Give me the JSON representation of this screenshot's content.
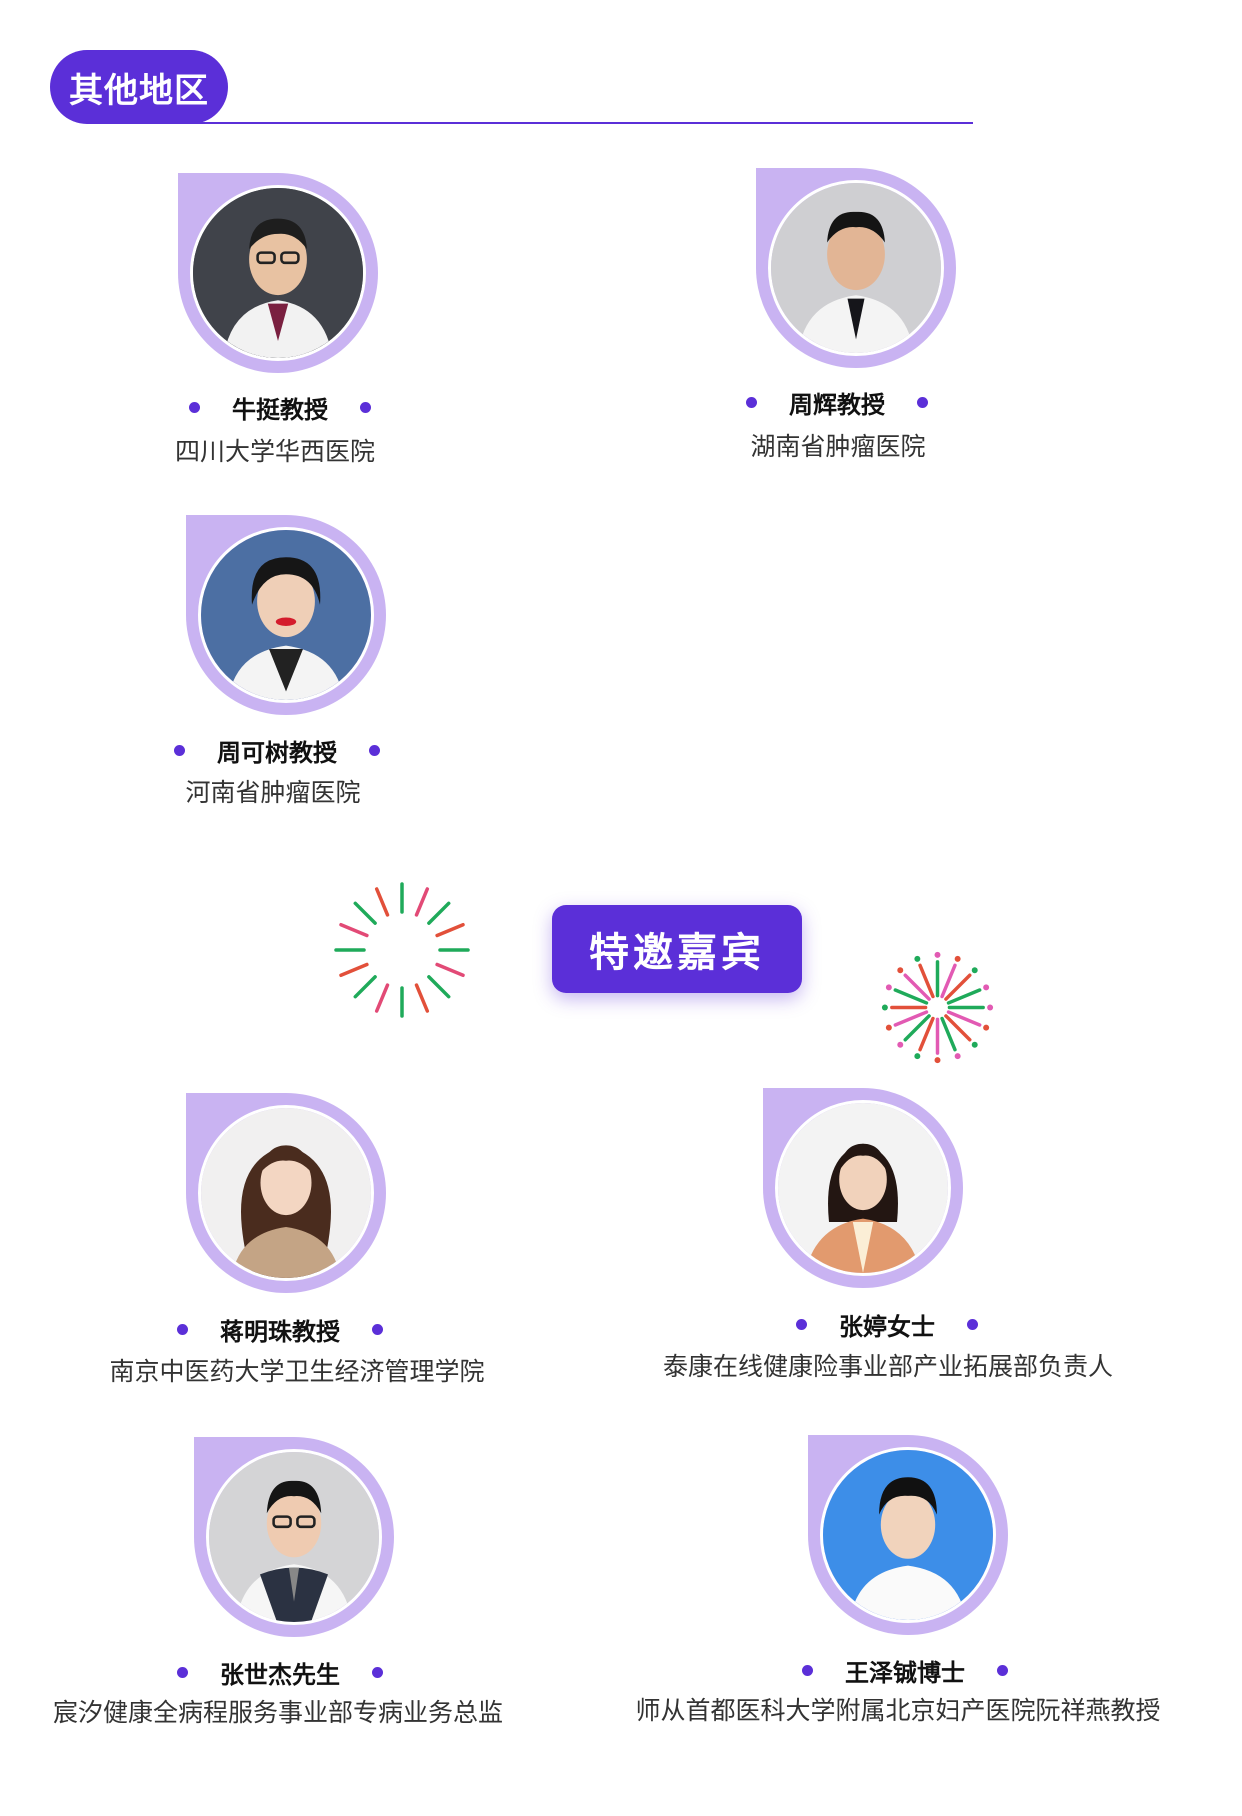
{
  "section": {
    "title": "其他地区"
  },
  "guest_header": {
    "label": "特邀嘉宾"
  },
  "colors": {
    "accent": "#5b2fd8",
    "photo_frame": "#c9b3f2"
  },
  "regional_speakers": [
    {
      "name": "牛挺教授",
      "affiliation": "四川大学华西医院"
    },
    {
      "name": "周辉教授",
      "affiliation": "湖南省肿瘤医院"
    },
    {
      "name": "周可树教授",
      "affiliation": "河南省肿瘤医院"
    }
  ],
  "guests": [
    {
      "name": "蒋明珠教授",
      "affiliation": "南京中医药大学卫生经济管理学院"
    },
    {
      "name": "张婷女士",
      "affiliation": "泰康在线健康险事业部产业拓展部负责人"
    },
    {
      "name": "张世杰先生",
      "affiliation": "宸汐健康全病程服务事业部专病业务总监"
    },
    {
      "name": "王泽铖博士",
      "affiliation": "师从首都医科大学附属北京妇产医院阮祥燕教授"
    }
  ]
}
